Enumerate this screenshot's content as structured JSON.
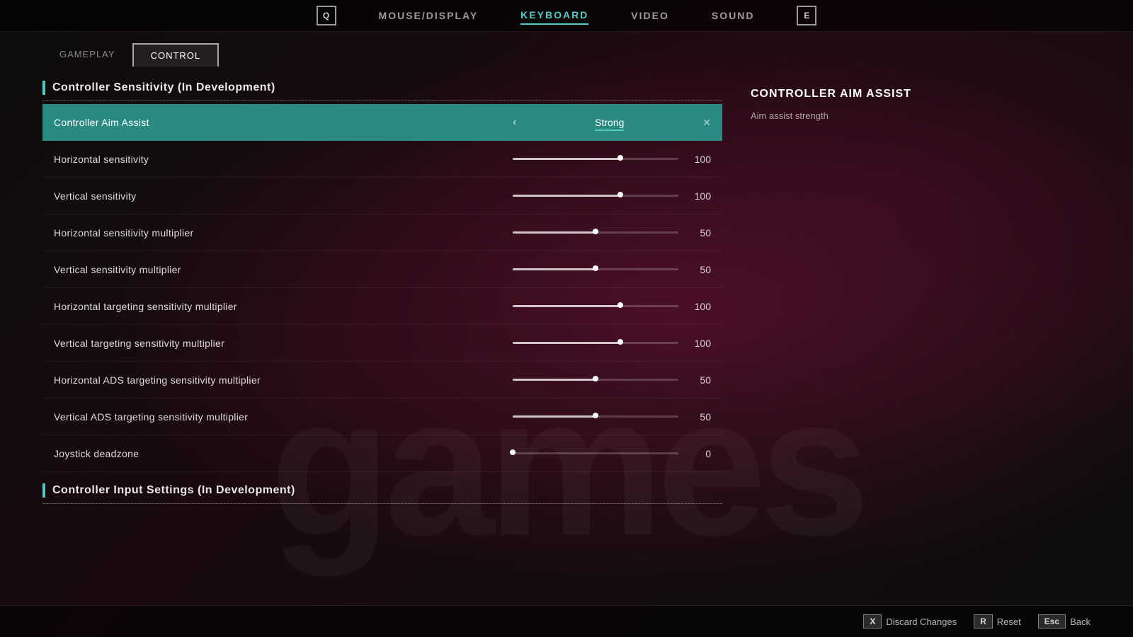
{
  "nav": {
    "left_key": "Q",
    "right_key": "E",
    "items": [
      {
        "label": "MOUSE/DISPLAY",
        "active": false
      },
      {
        "label": "KEYBOARD",
        "active": false
      },
      {
        "label": "VIDEO",
        "active": false
      },
      {
        "label": "SOUND",
        "active": false
      }
    ]
  },
  "sub_tabs": [
    {
      "label": "GAMEPLAY",
      "active": false
    },
    {
      "label": "CONTROL",
      "active": true
    }
  ],
  "section1": {
    "title": "Controller Sensitivity (In Development)",
    "bar_color": "#4ecdc4"
  },
  "settings": [
    {
      "id": "aim_assist",
      "label": "Controller Aim Assist",
      "type": "selector",
      "value": "Strong",
      "highlighted": true
    },
    {
      "id": "h_sensitivity",
      "label": "Horizontal sensitivity",
      "type": "slider",
      "value": 100,
      "fill_pct": 65
    },
    {
      "id": "v_sensitivity",
      "label": "Vertical sensitivity",
      "type": "slider",
      "value": 100,
      "fill_pct": 65
    },
    {
      "id": "h_sensitivity_mult",
      "label": "Horizontal sensitivity multiplier",
      "type": "slider",
      "value": 50,
      "fill_pct": 50
    },
    {
      "id": "v_sensitivity_mult",
      "label": "Vertical sensitivity multiplier",
      "type": "slider",
      "value": 50,
      "fill_pct": 50
    },
    {
      "id": "h_targeting_mult",
      "label": "Horizontal targeting sensitivity multiplier",
      "type": "slider",
      "value": 100,
      "fill_pct": 65
    },
    {
      "id": "v_targeting_mult",
      "label": "Vertical targeting sensitivity multiplier",
      "type": "slider",
      "value": 100,
      "fill_pct": 65
    },
    {
      "id": "h_ads_mult",
      "label": "Horizontal ADS targeting sensitivity multiplier",
      "type": "slider",
      "value": 50,
      "fill_pct": 50
    },
    {
      "id": "v_ads_mult",
      "label": "Vertical ADS targeting sensitivity multiplier",
      "type": "slider",
      "value": 50,
      "fill_pct": 50
    },
    {
      "id": "joystick_deadzone",
      "label": "Joystick deadzone",
      "type": "slider",
      "value": 0,
      "fill_pct": 0
    }
  ],
  "section2": {
    "title": "Controller Input Settings (In Development)"
  },
  "help": {
    "title": "CONTROLLER AIM ASSIST",
    "description": "Aim assist strength"
  },
  "watermark": "games",
  "bottom_actions": [
    {
      "key": "X",
      "label": "Discard Changes"
    },
    {
      "key": "R",
      "label": "Reset"
    },
    {
      "key": "Esc",
      "label": "Back"
    }
  ]
}
